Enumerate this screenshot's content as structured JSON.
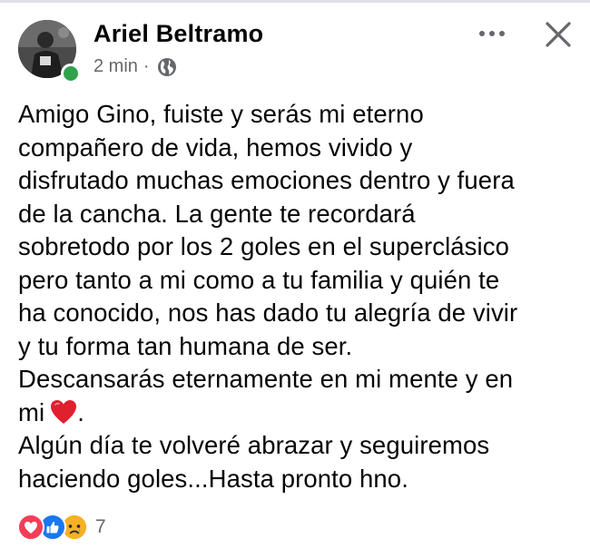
{
  "post": {
    "author": "Ariel Beltramo",
    "timestamp": "2 min",
    "separator": "·",
    "privacy_icon": "globe-icon",
    "body_lines": [
      "Amigo Gino, fuiste y serás mi eterno",
      "compañero de vida, hemos vivido y",
      "disfrutado muchas emociones dentro y fuera",
      "de la cancha. La gente te recordará",
      "sobretodo por los 2 goles en el superclásico",
      "pero tanto a mi como a tu familia y quién te",
      "ha conocido, nos has dado tu alegría de vivir",
      "y tu forma tan humana de ser.",
      "Descansarás eternamente en mi mente y en",
      "mi",
      "Algún día te volveré abrazar y seguiremos",
      "haciendo goles...Hasta pronto hno."
    ],
    "heart_suffix": "."
  },
  "reactions": {
    "icons": [
      "love-reaction-icon",
      "like-reaction-icon",
      "sad-reaction-icon"
    ],
    "count": "7"
  },
  "colors": {
    "text": "#050505",
    "secondary": "#65676b",
    "online": "#31a24c",
    "like_blue": "#1877f2",
    "love_red": "#f33e58",
    "sad_yellow": "#f7b125"
  }
}
